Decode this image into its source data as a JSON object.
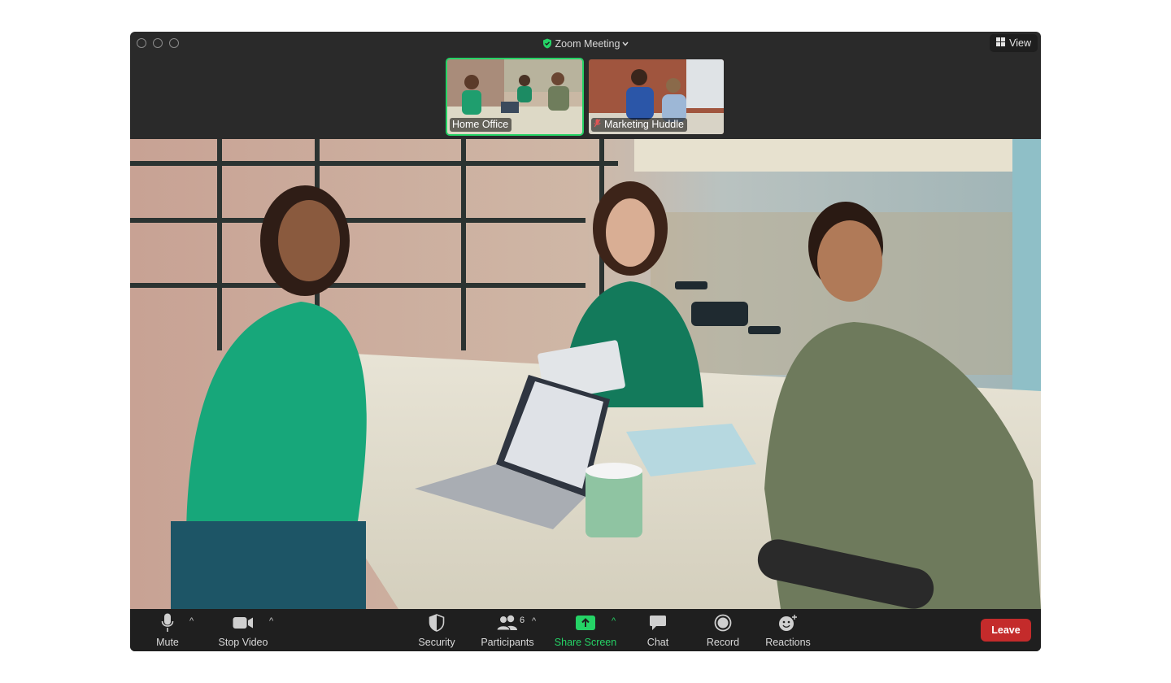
{
  "window": {
    "title": "Zoom Meeting",
    "view_label": "View"
  },
  "thumbnails": [
    {
      "label": "Home Office",
      "active": true,
      "muted": false
    },
    {
      "label": "Marketing Huddle",
      "active": false,
      "muted": true
    }
  ],
  "toolbar": {
    "mute_label": "Mute",
    "stop_video_label": "Stop Video",
    "security_label": "Security",
    "participants_label": "Participants",
    "participants_count": "6",
    "share_screen_label": "Share Screen",
    "chat_label": "Chat",
    "record_label": "Record",
    "reactions_label": "Reactions",
    "leave_label": "Leave"
  },
  "colors": {
    "accent": "#25d366",
    "leave": "#c42b2b",
    "toolbar_bg": "#1f1f1f",
    "window_bg": "#2a2a2a"
  },
  "icons": [
    "shield-check-icon",
    "chevron-down-icon",
    "grid-view-icon",
    "microphone-icon",
    "video-camera-icon",
    "security-shield-icon",
    "participants-icon",
    "share-screen-icon",
    "chat-bubble-icon",
    "record-icon",
    "reactions-icon",
    "muted-mic-icon"
  ]
}
